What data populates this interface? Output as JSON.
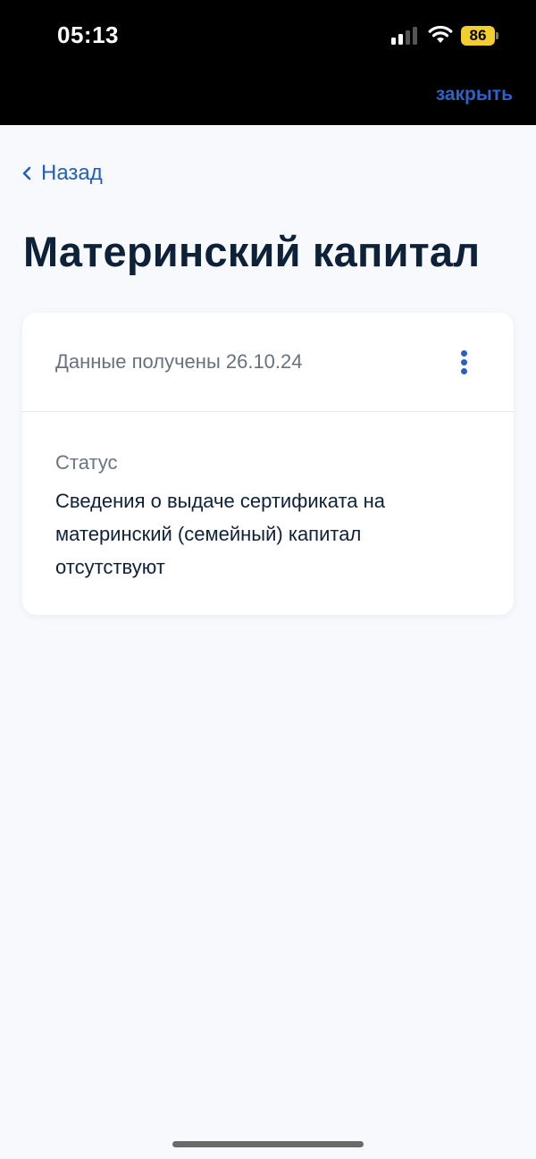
{
  "status_bar": {
    "time": "05:13",
    "battery_level": "86",
    "battery_color": "#f3cf2e",
    "signal_icon": "cellular-signal-icon",
    "wifi_icon": "wifi-icon"
  },
  "header": {
    "close_label": "закрыть"
  },
  "nav": {
    "back_label": "Назад",
    "back_icon": "chevron-left-icon"
  },
  "page": {
    "title": "Материнский капитал"
  },
  "card": {
    "date_text": "Данные получены 26.10.24",
    "menu_icon": "more-vertical-icon",
    "status_label": "Статус",
    "status_value": "Сведения о выдаче сертификата на материнский (семейный) капитал отсутствуют"
  },
  "colors": {
    "accent": "#2c63c9",
    "title": "#0d2138",
    "background": "#f8f9fd",
    "topbar": "#000000"
  }
}
